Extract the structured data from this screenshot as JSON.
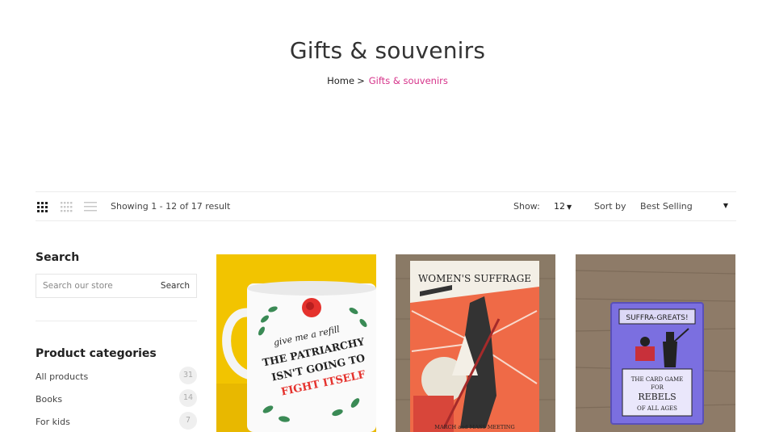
{
  "header": {
    "title": "Gifts & souvenirs",
    "breadcrumb": {
      "home": "Home",
      "separator": ">",
      "current": "Gifts & souvenirs"
    }
  },
  "toolbar": {
    "views": [
      "grid-3-icon",
      "grid-4-icon",
      "list-icon"
    ],
    "result_count": "Showing 1 - 12 of 17 result",
    "show_label": "Show:",
    "show_value": "12",
    "sort_label": "Sort by",
    "sort_value": "Best Selling"
  },
  "sidebar": {
    "search_title": "Search",
    "search_placeholder": "Search our store",
    "search_button": "Search",
    "categories_title": "Product categories",
    "categories": [
      {
        "label": "All products",
        "count": "31"
      },
      {
        "label": "Books",
        "count": "14"
      },
      {
        "label": "For kids",
        "count": "7"
      }
    ]
  },
  "products": [
    {
      "image": "mug-photo",
      "lines": [
        "give me a refill",
        "THE PATRIARCHY",
        "ISN'T GOING TO",
        "FIGHT ITSELF"
      ]
    },
    {
      "image": "tea-towel-photo",
      "lines": [
        "WOMEN'S SUFFRAGE",
        "MARCH and MASS MEETING"
      ]
    },
    {
      "image": "card-game-photo",
      "lines": [
        "SUFFRA-GREATS!",
        "THE CARD GAME",
        "FOR",
        "REBELS",
        "OF ALL AGES"
      ]
    }
  ],
  "colors": {
    "accent": "#d6338a",
    "text": "#222222",
    "muted": "#888888",
    "border": "#ececec"
  }
}
